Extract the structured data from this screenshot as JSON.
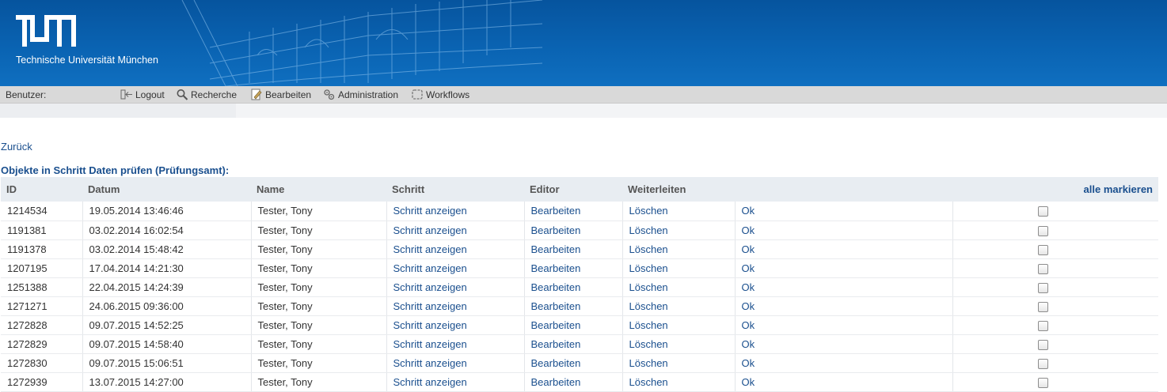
{
  "header": {
    "logo_text": "TUM",
    "university_name": "Technische Universität München"
  },
  "menubar": {
    "user_label": "Benutzer:",
    "items": [
      {
        "label": "Logout",
        "icon": "logout-icon"
      },
      {
        "label": "Recherche",
        "icon": "search-icon"
      },
      {
        "label": "Bearbeiten",
        "icon": "edit-icon"
      },
      {
        "label": "Administration",
        "icon": "admin-icon"
      },
      {
        "label": "Workflows",
        "icon": "workflow-icon"
      }
    ]
  },
  "back_link": "Zurück",
  "section_title": "Objekte in Schritt Daten prüfen (Prüfungsamt):",
  "table": {
    "headers": [
      "ID",
      "Datum",
      "Name",
      "Schritt",
      "Editor",
      "Weiterleiten"
    ],
    "mark_all": "alle markieren",
    "rows": [
      {
        "id": "1214534",
        "date": "19.05.2014 13:46:46",
        "name": "Tester, Tony",
        "step": "Schritt anzeigen",
        "editor": "Bearbeiten",
        "delete": "Löschen",
        "ok": "Ok"
      },
      {
        "id": "1191381",
        "date": "03.02.2014 16:02:54",
        "name": "Tester, Tony",
        "step": "Schritt anzeigen",
        "editor": "Bearbeiten",
        "delete": "Löschen",
        "ok": "Ok"
      },
      {
        "id": "1191378",
        "date": "03.02.2014 15:48:42",
        "name": "Tester, Tony",
        "step": "Schritt anzeigen",
        "editor": "Bearbeiten",
        "delete": "Löschen",
        "ok": "Ok"
      },
      {
        "id": "1207195",
        "date": "17.04.2014 14:21:30",
        "name": "Tester, Tony",
        "step": "Schritt anzeigen",
        "editor": "Bearbeiten",
        "delete": "Löschen",
        "ok": "Ok"
      },
      {
        "id": "1251388",
        "date": "22.04.2015 14:24:39",
        "name": "Tester, Tony",
        "step": "Schritt anzeigen",
        "editor": "Bearbeiten",
        "delete": "Löschen",
        "ok": "Ok"
      },
      {
        "id": "1271271",
        "date": "24.06.2015 09:36:00",
        "name": "Tester, Tony",
        "step": "Schritt anzeigen",
        "editor": "Bearbeiten",
        "delete": "Löschen",
        "ok": "Ok"
      },
      {
        "id": "1272828",
        "date": "09.07.2015 14:52:25",
        "name": "Tester, Tony",
        "step": "Schritt anzeigen",
        "editor": "Bearbeiten",
        "delete": "Löschen",
        "ok": "Ok"
      },
      {
        "id": "1272829",
        "date": "09.07.2015 14:58:40",
        "name": "Tester, Tony",
        "step": "Schritt anzeigen",
        "editor": "Bearbeiten",
        "delete": "Löschen",
        "ok": "Ok"
      },
      {
        "id": "1272830",
        "date": "09.07.2015 15:06:51",
        "name": "Tester, Tony",
        "step": "Schritt anzeigen",
        "editor": "Bearbeiten",
        "delete": "Löschen",
        "ok": "Ok"
      },
      {
        "id": "1272939",
        "date": "13.07.2015 14:27:00",
        "name": "Tester, Tony",
        "step": "Schritt anzeigen",
        "editor": "Bearbeiten",
        "delete": "Löschen",
        "ok": "Ok"
      }
    ]
  },
  "colors": {
    "header_blue": "#0a63b2",
    "link_blue": "#1a4f8e",
    "menubar_gray": "#d9d9d9",
    "table_header_bg": "#e8edf2"
  }
}
